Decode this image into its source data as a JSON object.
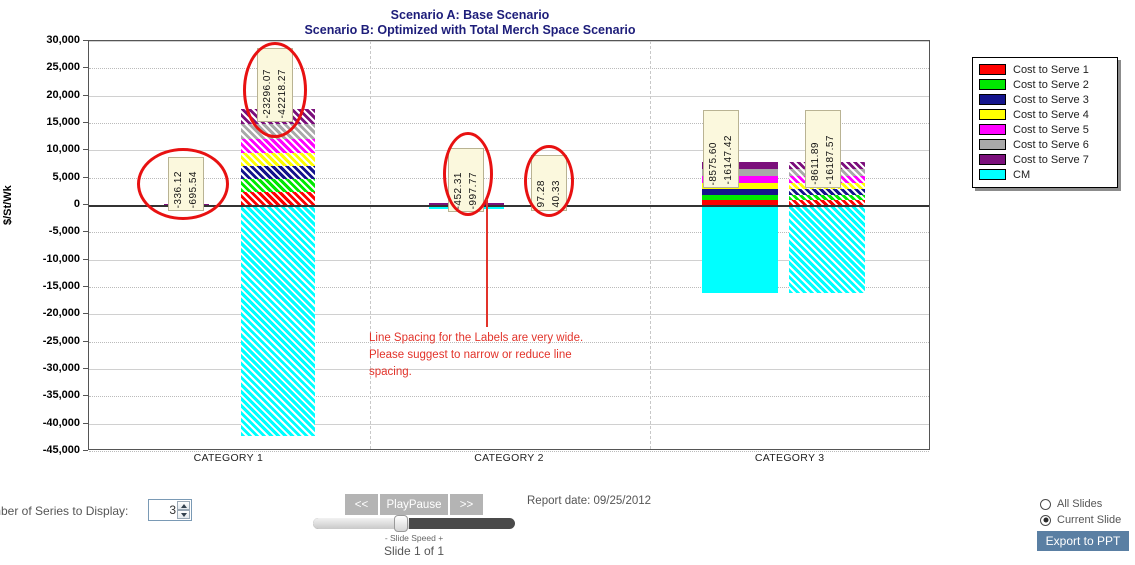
{
  "chart_data": {
    "type": "bar",
    "title": "Scenario A: Base Scenario\nScenario B: Optimized with Total Merch Space Scenario",
    "title_line1": "Scenario A: Base Scenario",
    "title_line2": "Scenario B: Optimized with Total Merch Space Scenario",
    "xlabel": "",
    "ylabel": "$/St/Wk",
    "ylim": [
      -45000,
      30000
    ],
    "ytick_step": 5000,
    "ytick_labels": [
      "30,000",
      "25,000",
      "20,000",
      "15,000",
      "10,000",
      "5,000",
      "0",
      "-5,000",
      "-10,000",
      "-15,000",
      "-20,000",
      "-25,000",
      "-30,000",
      "-35,000",
      "-40,000",
      "-45,000"
    ],
    "ytick_values": [
      30000,
      25000,
      20000,
      15000,
      10000,
      5000,
      0,
      -5000,
      -10000,
      -15000,
      -20000,
      -25000,
      -30000,
      -35000,
      -40000,
      -45000
    ],
    "categories": [
      "CATEGORY 1",
      "CATEGORY 2",
      "CATEGORY 3"
    ],
    "grid": true,
    "legend_position": "right",
    "stacked": true,
    "series": [
      {
        "name": "Cost to Serve 1",
        "color": "#ff0000"
      },
      {
        "name": "Cost to Serve 2",
        "color": "#00e800"
      },
      {
        "name": "Cost to Serve 3",
        "color": "#14148c"
      },
      {
        "name": "Cost to Serve 4",
        "color": "#ffff00"
      },
      {
        "name": "Cost to Serve 5",
        "color": "#ff00ff"
      },
      {
        "name": "Cost to Serve 6",
        "color": "#a8a8a8"
      },
      {
        "name": "Cost to Serve 7",
        "color": "#7b0f7b"
      },
      {
        "name": "CM",
        "color": "#00ffff"
      }
    ],
    "bars": [
      {
        "category": "CATEGORY 1",
        "scenario": "A",
        "hatched": false,
        "total_label": "-336.12",
        "segments": [
          {
            "series": "Cost to Serve 7",
            "value": 120
          },
          {
            "series": "CM",
            "value": -456
          }
        ]
      },
      {
        "category": "CATEGORY 1",
        "scenario": "B",
        "hatched": true,
        "total_label": "-42218.27",
        "secondary_label": "-23296.07",
        "segments": [
          {
            "series": "Cost to Serve 1",
            "value": 2450
          },
          {
            "series": "Cost to Serve 2",
            "value": 2300
          },
          {
            "series": "Cost to Serve 3",
            "value": 2350
          },
          {
            "series": "Cost to Serve 4",
            "value": 2400
          },
          {
            "series": "Cost to Serve 5",
            "value": 2500
          },
          {
            "series": "Cost to Serve 6",
            "value": 2750
          },
          {
            "series": "Cost to Serve 7",
            "value": 2750
          },
          {
            "series": "CM",
            "value": -42218
          }
        ]
      },
      {
        "category": "CATEGORY 2",
        "scenario": "A",
        "hatched": false,
        "total_label": "-452.31",
        "segments": [
          {
            "series": "Cost to Serve 7",
            "value": 320
          },
          {
            "series": "CM",
            "value": -700
          }
        ]
      },
      {
        "category": "CATEGORY 2",
        "scenario": "B",
        "hatched": true,
        "total_label": "97.28",
        "segments": [
          {
            "series": "Cost to Serve 7",
            "value": 60
          }
        ]
      },
      {
        "category": "CATEGORY 3",
        "scenario": "A",
        "hatched": false,
        "total_label": "-8575.60",
        "segments": [
          {
            "series": "Cost to Serve 1",
            "value": 950
          },
          {
            "series": "Cost to Serve 2",
            "value": 900
          },
          {
            "series": "Cost to Serve 3",
            "value": 1000
          },
          {
            "series": "Cost to Serve 4",
            "value": 1200
          },
          {
            "series": "Cost to Serve 5",
            "value": 1250
          },
          {
            "series": "Cost to Serve 6",
            "value": 1250
          },
          {
            "series": "Cost to Serve 7",
            "value": 1350
          },
          {
            "series": "CM",
            "value": -16147
          }
        ]
      },
      {
        "category": "CATEGORY 3",
        "scenario": "B",
        "hatched": true,
        "total_label": "-8611.89",
        "segments": [
          {
            "series": "Cost to Serve 1",
            "value": 950
          },
          {
            "series": "Cost to Serve 2",
            "value": 900
          },
          {
            "series": "Cost to Serve 3",
            "value": 1000
          },
          {
            "series": "Cost to Serve 4",
            "value": 1200
          },
          {
            "series": "Cost to Serve 5",
            "value": 1250
          },
          {
            "series": "Cost to Serve 6",
            "value": 1250
          },
          {
            "series": "Cost to Serve 7",
            "value": 1350
          },
          {
            "series": "CM",
            "value": -16187
          }
        ]
      }
    ],
    "data_labels": [
      {
        "id": "cat1-a",
        "values": [
          "-336.12",
          "-695.54"
        ],
        "circled": true
      },
      {
        "id": "cat1-b",
        "values": [
          "-23296.07",
          "-42218.27"
        ],
        "circled": true
      },
      {
        "id": "cat2-a",
        "values": [
          "-452.31",
          "-997.77"
        ],
        "circled": true
      },
      {
        "id": "cat2-b",
        "values": [
          "97.28",
          "40.33"
        ],
        "circled": true
      },
      {
        "id": "cat3-a",
        "values": [
          "-8575.60",
          "-16147.42"
        ],
        "circled": false
      },
      {
        "id": "cat3-b",
        "values": [
          "-8611.89",
          "-16187.57"
        ],
        "circled": false
      }
    ],
    "annotation": "Line Spacing for the Labels are very wide. Please suggest to narrow or reduce line spacing."
  },
  "legend": {
    "items": [
      {
        "label": "Cost to Serve 1",
        "color": "#ff0000"
      },
      {
        "label": "Cost to Serve 2",
        "color": "#00e800"
      },
      {
        "label": "Cost to Serve 3",
        "color": "#14148c"
      },
      {
        "label": "Cost to Serve 4",
        "color": "#ffff00"
      },
      {
        "label": "Cost to Serve 5",
        "color": "#ff00ff"
      },
      {
        "label": "Cost to Serve 6",
        "color": "#a8a8a8"
      },
      {
        "label": "Cost to Serve 7",
        "color": "#7b0f7b"
      },
      {
        "label": "CM",
        "color": "#00ffff"
      }
    ]
  },
  "controls": {
    "series_label": "mber of Series to Display:",
    "series_value": "3",
    "prev_label": "<<",
    "playpause_label": "PlayPause",
    "next_label": ">>",
    "speed_caption": "- Slide Speed +",
    "slide_counter": "Slide 1 of 1",
    "report_date": "Report date: 09/25/2012",
    "radio_all": "All Slides",
    "radio_current": "Current Slide",
    "export_label": "Export to PPT"
  },
  "colors": {
    "title": "#1d1d7a",
    "annotation": "#e2332a",
    "callout": "#e81111",
    "export_btn": "#5a7fa3",
    "label_box": "#fbf8dd"
  }
}
